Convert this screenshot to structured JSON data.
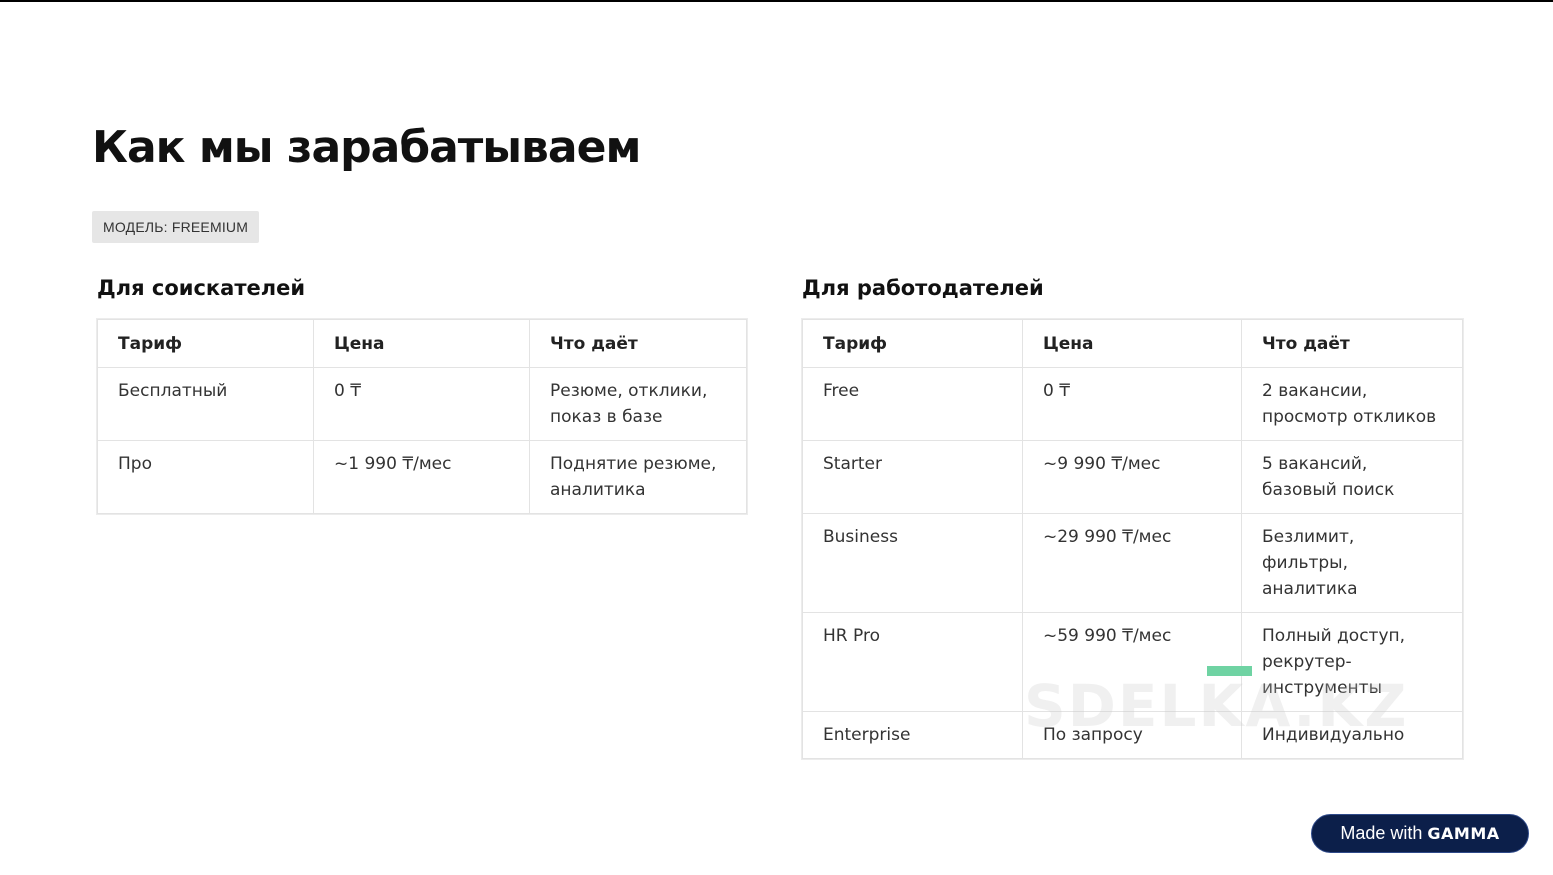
{
  "slide": {
    "title": "Как мы зарабатываем",
    "badge": "МОДЕЛЬ: FREEMIUM"
  },
  "seekers": {
    "title": "Для соискателей",
    "headers": [
      "Тариф",
      "Цена",
      "Что даёт"
    ],
    "rows": [
      [
        "Бесплатный",
        "0 ₸",
        "Резюме, отклики, показ в базе"
      ],
      [
        "Про",
        "~1 990 ₸/мес",
        "Поднятие резюме, аналитика"
      ]
    ]
  },
  "employers": {
    "title": "Для работодателей",
    "headers": [
      "Тариф",
      "Цена",
      "Что даёт"
    ],
    "rows": [
      [
        "Free",
        "0 ₸",
        "2 вакансии, просмотр откликов"
      ],
      [
        "Starter",
        "~9 990 ₸/мес",
        "5 вакансий, базовый поиск"
      ],
      [
        "Business",
        "~29 990 ₸/мес",
        "Безлимит, фильтры, аналитика"
      ],
      [
        "HR Pro",
        "~59 990 ₸/мес",
        "Полный доступ, рекрутер-инструменты"
      ],
      [
        "Enterprise",
        "По запросу",
        "Индивидуально"
      ]
    ]
  },
  "watermark": "SDELKA.KZ",
  "made_with": {
    "prefix": "Made with",
    "brand": "GAMMA"
  },
  "colors": {
    "badge_bg": "#e6e6e6",
    "made_with_bg": "#0c1f4a",
    "watermark_accent": "#6fd3a3"
  }
}
